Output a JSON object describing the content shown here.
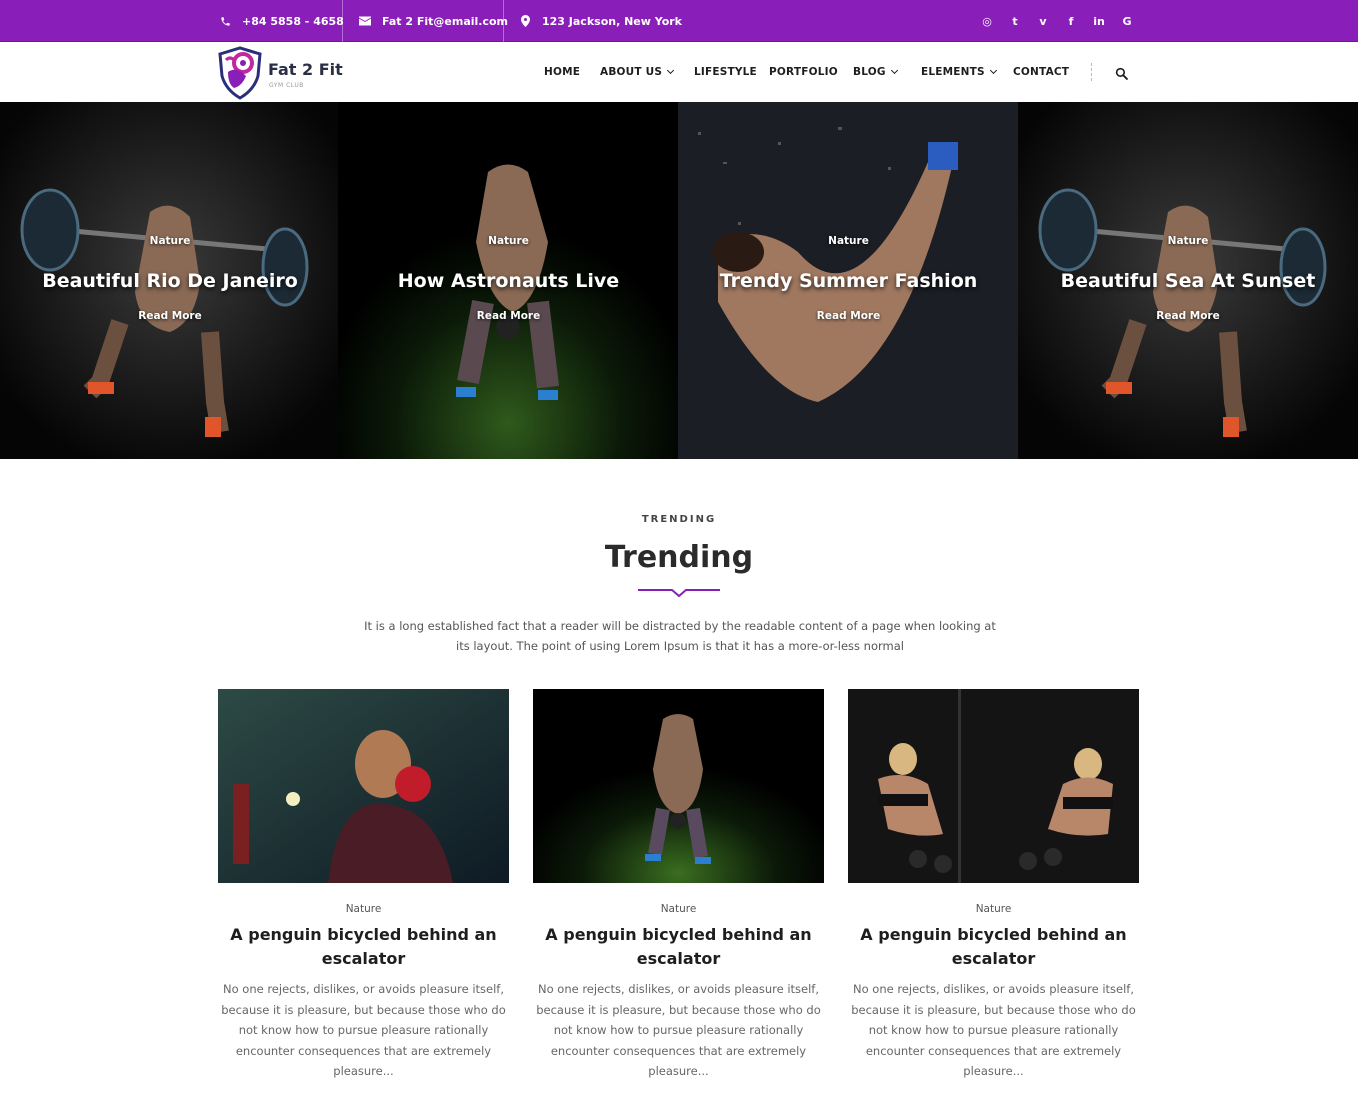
{
  "topbar": {
    "phone": "+84 5858 - 4658",
    "email": "Fat 2 Fit@email.com",
    "address": "123 Jackson, New York",
    "phone_icon": "phone-icon",
    "email_icon": "envelope-icon",
    "address_icon": "map-pin-icon",
    "social": [
      "instagram",
      "twitter",
      "vimeo",
      "facebook",
      "linkedin",
      "google"
    ],
    "social_glyphs": [
      "◎",
      "t",
      "v",
      "f",
      "in",
      "G"
    ]
  },
  "logo": {
    "name": "Fat 2 Fit",
    "tagline": "GYM CLUB"
  },
  "nav": {
    "items": [
      "HOME",
      "ABOUT US",
      "LIFESTYLE",
      "PORTFOLIO",
      "BLOG",
      "ELEMENTS",
      "CONTACT"
    ]
  },
  "hero": {
    "slides": [
      {
        "category": "Nature",
        "title": "Beautiful Rio De Janeiro",
        "cta": "Read More"
      },
      {
        "category": "Nature",
        "title": "How Astronauts Live",
        "cta": "Read More"
      },
      {
        "category": "Nature",
        "title": "Trendy Summer Fashion",
        "cta": "Read More"
      },
      {
        "category": "Nature",
        "title": "Beautiful Sea At Sunset",
        "cta": "Read More"
      }
    ]
  },
  "trending": {
    "eyebrow": "TRENDING",
    "heading": "Trending",
    "lead": "It is a long established fact that a reader will be distracted by the readable content of a page when looking at its layout. The point of using Lorem Ipsum is that it has a more-or-less normal"
  },
  "cards": [
    {
      "category": "Nature",
      "title": "A penguin bicycled behind an escalator",
      "excerpt": "No one rejects, dislikes, or avoids pleasure itself, because it is pleasure, but because those who do not know how to pursue pleasure rationally encounter consequences that are extremely pleasure..."
    },
    {
      "category": "Nature",
      "title": "A penguin bicycled behind an escalator",
      "excerpt": "No one rejects, dislikes, or avoids pleasure itself, because it is pleasure, but because those who do not know how to pursue pleasure rationally encounter consequences that are extremely pleasure..."
    },
    {
      "category": "Nature",
      "title": "A penguin bicycled behind an escalator",
      "excerpt": "No one rejects, dislikes, or avoids pleasure itself, because it is pleasure, but because those who do not know how to pursue pleasure rationally encounter consequences that are extremely pleasure..."
    }
  ],
  "colors": {
    "brand": "#8a1eb8",
    "text_dark": "#1e1e1e"
  }
}
